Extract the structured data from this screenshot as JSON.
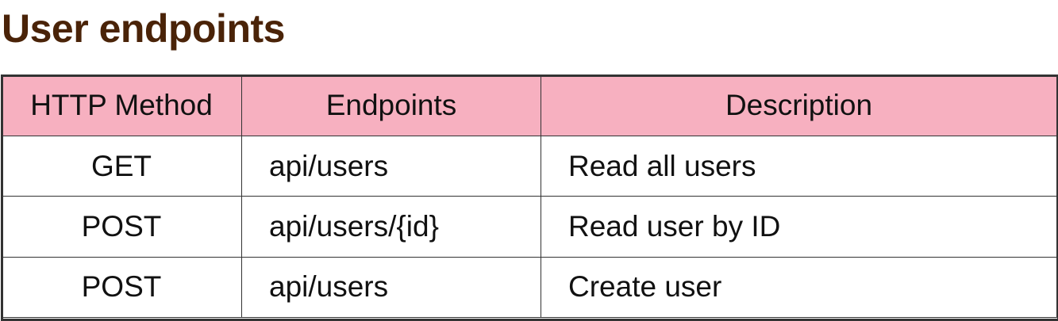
{
  "page": {
    "title": "User endpoints"
  },
  "colors": {
    "title": "#4a2308",
    "header_background": "#f7b0c0",
    "border": "#333333"
  },
  "table": {
    "headers": [
      "HTTP Method",
      "Endpoints",
      "Description"
    ],
    "rows": [
      {
        "method": "GET",
        "endpoint": "api/users",
        "description": "Read all users"
      },
      {
        "method": "POST",
        "endpoint": "api/users/{id}",
        "description": "Read user by ID"
      },
      {
        "method": "POST",
        "endpoint": "api/users",
        "description": "Create user"
      }
    ]
  }
}
